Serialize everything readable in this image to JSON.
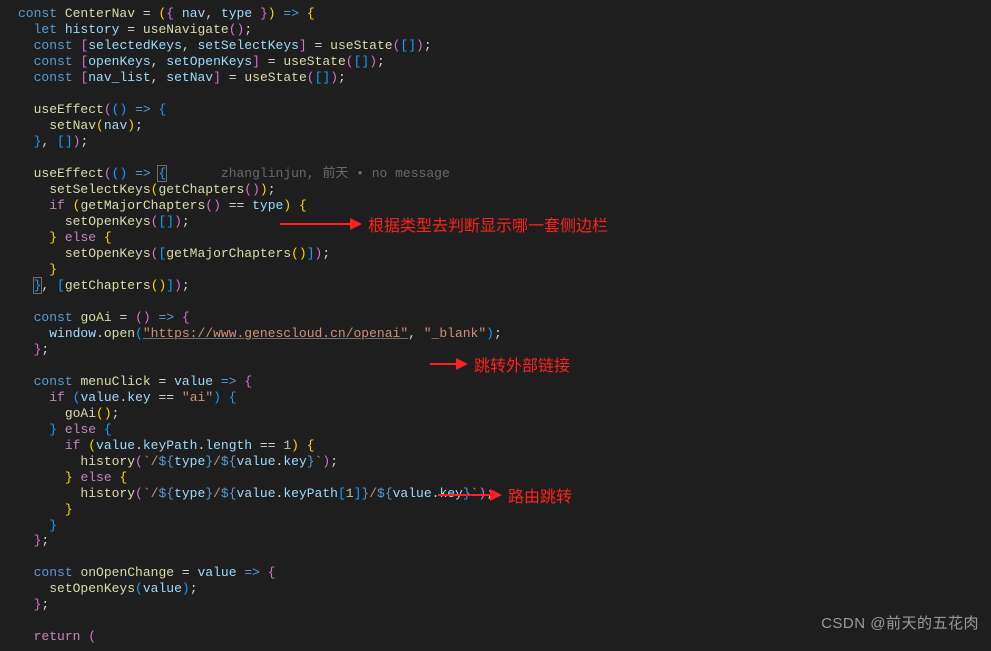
{
  "code": {
    "l1": "const CenterNav = ({ nav, type }) => {",
    "l2": "  let history = useNavigate();",
    "l3": "  const [selectedKeys, setSelectKeys] = useState([]);",
    "l4": "  const [openKeys, setOpenKeys] = useState([]);",
    "l5": "  const [nav_list, setNav] = useState([]);",
    "l6": "",
    "l7": "  useEffect(() => {",
    "l8": "    setNav(nav);",
    "l9": "  }, []);",
    "l10": "",
    "l11": "  useEffect(() => {",
    "l11b": "zhanglinjun, 前天 • no message",
    "l12": "    setSelectKeys(getChapters());",
    "l13": "    if (getMajorChapters() == type) {",
    "l14": "      setOpenKeys([]);",
    "l15": "    } else {",
    "l16": "      setOpenKeys([getMajorChapters()]);",
    "l17": "    }",
    "l18": "  }, [getChapters()]);",
    "l19": "",
    "l20": "  const goAi = () => {",
    "l21": "    window.open(\"https://www.genescloud.cn/openai\", \"_blank\");",
    "l22": "  };",
    "l23": "",
    "l24": "  const menuClick = value => {",
    "l25": "    if (value.key == \"ai\") {",
    "l26": "      goAi();",
    "l27": "    } else {",
    "l28": "      if (value.keyPath.length == 1) {",
    "l29": "        history(`/${type}/${value.key}`);",
    "l30": "      } else {",
    "l31": "        history(`/${type}/${value.keyPath[1]}/${value.key}`);",
    "l32": "      }",
    "l33": "    }",
    "l34": "  };",
    "l35": "",
    "l36": "  const onOpenChange = value => {",
    "l37": "    setOpenKeys(value);",
    "l38": "  };",
    "l39": "",
    "l40": "  return ("
  },
  "annotations": {
    "a1": "根据类型去判断显示哪一套侧边栏",
    "a2": "跳转外部链接",
    "a3": "路由跳转"
  },
  "watermark": "CSDN @前天的五花肉"
}
